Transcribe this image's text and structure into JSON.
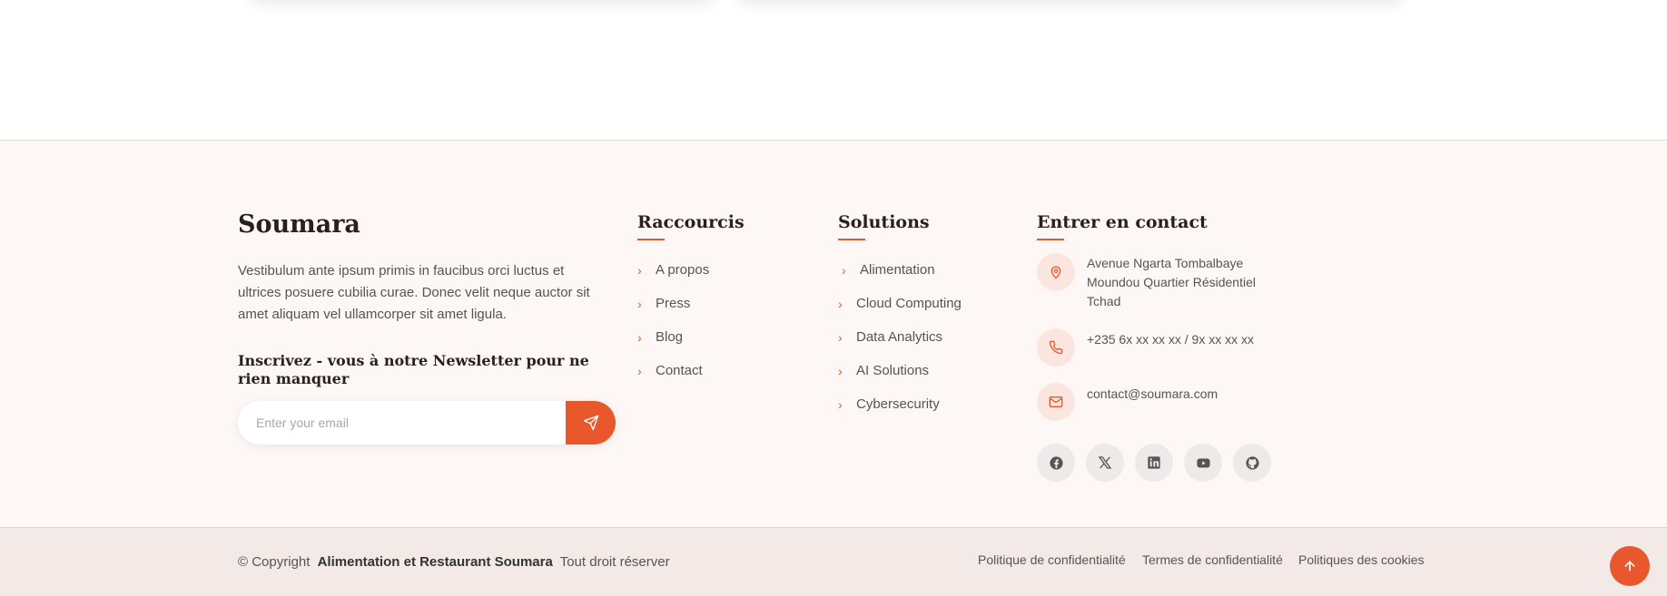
{
  "footer": {
    "brand": "Soumara",
    "about": "Vestibulum ante ipsum primis in faucibus orci luctus et ultrices posuere cubilia curae. Donec velit neque auctor sit amet aliquam vel ullamcorper sit amet ligula.",
    "newsletter": {
      "title": "Inscrivez - vous à notre Newsletter pour ne rien manquer",
      "placeholder": "Enter your email",
      "submit_icon": "send-icon"
    },
    "shortcuts": {
      "title": "Raccourcis",
      "items": [
        "A propos",
        "Press",
        "Blog",
        "Contact"
      ]
    },
    "solutions": {
      "title": "Solutions",
      "items": [
        "Alimentation",
        "Cloud Computing",
        "Data Analytics",
        "AI Solutions",
        "Cybersecurity"
      ]
    },
    "contact": {
      "title": "Entrer en contact",
      "address_lines": [
        "Avenue Ngarta Tombalbaye",
        "Moundou Quartier Résidentiel",
        "Tchad"
      ],
      "phone": "+235 6x xx xx xx / 9x xx xx xx",
      "email": "contact@soumara.com",
      "icons": [
        "map-pin-icon",
        "phone-icon",
        "mail-icon"
      ]
    },
    "social_icons": [
      "facebook-icon",
      "x-icon",
      "linkedin-icon",
      "youtube-icon",
      "github-icon"
    ]
  },
  "bottom": {
    "copyright_prefix": "© Copyright",
    "company": "Alimentation et Restaurant Soumara",
    "rights": "Tout droit réserver",
    "links": [
      "Politique de confidentialité",
      "Termes de confidentialité",
      "Politiques des cookies"
    ]
  },
  "colors": {
    "accent": "#e8582c",
    "footer_bg": "#fdf7f5",
    "bottom_bg": "#f3e9e7"
  }
}
